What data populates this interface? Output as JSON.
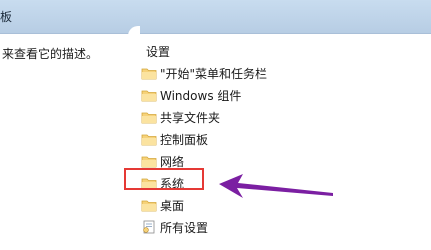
{
  "window": {
    "title_fragment": "板"
  },
  "left_pane": {
    "description": "来查看它的描述。"
  },
  "right_pane": {
    "header": "设置",
    "items": [
      {
        "label": "\"开始\"菜单和任务栏",
        "icon": "folder-icon"
      },
      {
        "label": "Windows 组件",
        "icon": "folder-icon"
      },
      {
        "label": "共享文件夹",
        "icon": "folder-icon"
      },
      {
        "label": "控制面板",
        "icon": "folder-icon"
      },
      {
        "label": "网络",
        "icon": "folder-icon"
      },
      {
        "label": "系统",
        "icon": "folder-icon"
      },
      {
        "label": "桌面",
        "icon": "folder-icon"
      },
      {
        "label": "所有设置",
        "icon": "settings-page-icon"
      }
    ]
  },
  "annotation": {
    "highlight_color": "#e53935",
    "arrow_color": "#7b1fa2",
    "target_item": "系统"
  }
}
